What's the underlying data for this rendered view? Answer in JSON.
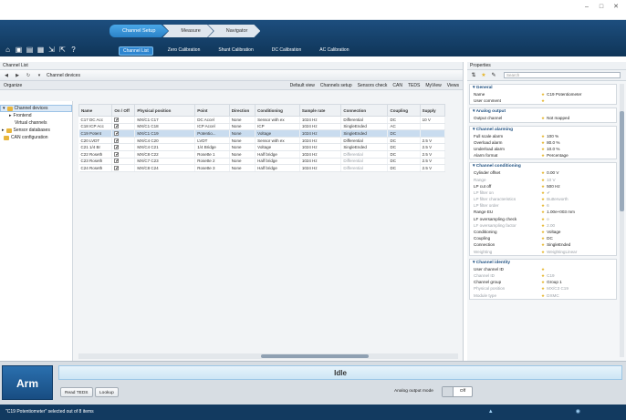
{
  "main_tabs": [
    "Channel Setup",
    "Measure",
    "Navigator"
  ],
  "sub_tabs": [
    "Channel List",
    "Zero Calibration",
    "Shunt Calibration",
    "DC Calibration",
    "AC Calibration"
  ],
  "channel_list": {
    "panel_title": "Channel List",
    "breadcrumb": "Channel devices",
    "organize_label": "Organize",
    "view_filters": [
      "Default view",
      "Channels setup",
      "Sensors check",
      "CAN",
      "TEDS",
      "MyView"
    ],
    "views_label": "Views"
  },
  "tree": [
    {
      "label": "Channel devices",
      "selected": true
    },
    {
      "label": "Frontend",
      "selected": false
    },
    {
      "label": "Virtual channels",
      "selected": false
    },
    {
      "label": "Sensor databases",
      "selected": false
    },
    {
      "label": "CAN configuration",
      "selected": false
    }
  ],
  "table": {
    "columns": [
      "Name",
      "On / Off",
      "Physical position",
      "Point",
      "Direction",
      "Conditioning",
      "Sample rate",
      "Connection",
      "Coupling",
      "Supply"
    ],
    "rows": [
      [
        "C17 DC Acc",
        "✔",
        "MX/C1 C17",
        "DC Accel",
        "None",
        "Sensor with ex",
        "1024 Hz",
        "Differential",
        "DC",
        "10 V"
      ],
      [
        "C18 ICP Acc",
        "✔",
        "MX/C1 C18",
        "ICP Accel",
        "None",
        "ICP",
        "1024 Hz",
        "SingleEnded",
        "AC",
        ""
      ],
      [
        "C19 Potent",
        "✔",
        "MX/C1 C19",
        "Potentio...",
        "None",
        "Voltage",
        "1024 Hz",
        "SingleEnded",
        "DC",
        ""
      ],
      [
        "C20 LVDT",
        "✔",
        "MX/C4 C20",
        "LVDT",
        "None",
        "Sensor with ex",
        "1024 Hz",
        "Differential",
        "DC",
        "2.5 V"
      ],
      [
        "C21 1/4 Br",
        "✔",
        "MX/C4 C21",
        "1/4 Bridge",
        "None",
        "Voltage",
        "1024 Hz",
        "SingleEnded",
        "DC",
        "2.5 V"
      ],
      [
        "C22 Roseth",
        "✔",
        "MX/C8 C22",
        "Rosette 1",
        "None",
        "Half bridge",
        "1024 Hz",
        "Differential",
        "DC",
        "2.5 V"
      ],
      [
        "C23 Roseth",
        "✔",
        "MX/C7 C23",
        "Rosette 2",
        "None",
        "Half bridge",
        "1024 Hz",
        "Differential",
        "DC",
        "2.5 V"
      ],
      [
        "C24 Roseth",
        "✔",
        "MX/C8 C24",
        "Rosette 3",
        "None",
        "Half bridge",
        "1024 Hz",
        "Differential",
        "DC",
        "2.5 V"
      ]
    ]
  },
  "properties": {
    "panel_title": "Properties",
    "search_placeholder": "Search",
    "sections": [
      {
        "title": "General",
        "rows": [
          {
            "k": "Name",
            "v": "C19 Potentiometer",
            "dim": false
          },
          {
            "k": "User comment",
            "v": "",
            "dim": false
          }
        ]
      },
      {
        "title": "Analog output",
        "rows": [
          {
            "k": "Output channel",
            "v": "Not mapped",
            "dim": false
          }
        ]
      },
      {
        "title": "Channel alarming",
        "rows": [
          {
            "k": "Full scale alarm",
            "v": "100 %",
            "dim": false
          },
          {
            "k": "Overload alarm",
            "v": "80.0 %",
            "dim": false
          },
          {
            "k": "Underload alarm",
            "v": "10.0 %",
            "dim": false
          },
          {
            "k": "Alarm format",
            "v": "Percentage",
            "dim": false
          }
        ]
      },
      {
        "title": "Channel conditioning",
        "rows": [
          {
            "k": "Cylinder offset",
            "v": "0.00 V",
            "dim": false
          },
          {
            "k": "Range",
            "v": "10 V",
            "dim": true
          },
          {
            "k": "LP cut off",
            "v": "500 Hz",
            "dim": false
          },
          {
            "k": "LP filter on",
            "v": "✔",
            "dim": true
          },
          {
            "k": "LP filter characteristics",
            "v": "Butterworth",
            "dim": true
          },
          {
            "k": "LP filter order",
            "v": "6",
            "dim": true
          },
          {
            "k": "Range EU",
            "v": "1.00e+003 mm",
            "dim": false
          },
          {
            "k": "LF oversampling check",
            "v": "○",
            "dim": false
          },
          {
            "k": "LF oversampling factor",
            "v": "2.00",
            "dim": true
          },
          {
            "k": "Conditioning",
            "v": "Voltage",
            "dim": false
          },
          {
            "k": "Coupling",
            "v": "DC",
            "dim": false
          },
          {
            "k": "Connection",
            "v": "SingleEnded",
            "dim": false
          },
          {
            "k": "Weighting",
            "v": "WeightingLinear",
            "dim": true
          }
        ]
      },
      {
        "title": "Channel identity",
        "rows": [
          {
            "k": "User channel ID",
            "v": "",
            "dim": false
          },
          {
            "k": "Channel ID",
            "v": "C19",
            "dim": true
          },
          {
            "k": "Channel group",
            "v": "Group 1",
            "dim": false
          },
          {
            "k": "Physical position",
            "v": "MX/C3 C19",
            "dim": true
          },
          {
            "k": "Module type",
            "v": "DXMC",
            "dim": true
          }
        ]
      }
    ]
  },
  "bottom": {
    "arm_label": "Arm",
    "status": "Idle",
    "read_teds_label": "Read TEDS",
    "lookup_label": "Lookup",
    "analog_output_label": "Analog output mode",
    "toggle_label": "Off"
  },
  "statusbar": {
    "text": "\"C19 Potentiometer\" selected out of 8 items"
  },
  "colors": {
    "accent": "#2b82c8",
    "header_band": "#0f3558",
    "selection": "#c9dcef"
  }
}
